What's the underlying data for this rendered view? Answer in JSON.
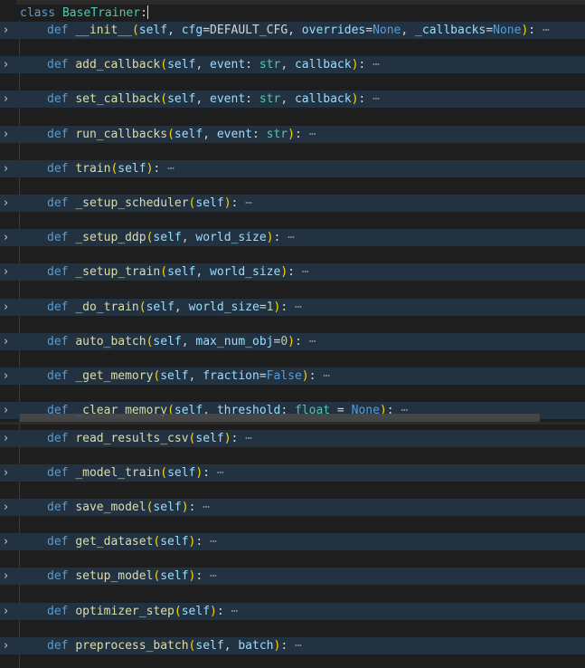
{
  "editor": {
    "class_line": {
      "keyword": "class",
      "name": "BaseTrainer",
      "colon": ":"
    },
    "methods": [
      {
        "name": "__init__",
        "tokens": [
          {
            "t": "(",
            "c": "paren"
          },
          {
            "t": "self",
            "c": "param"
          },
          {
            "t": ", ",
            "c": "plain"
          },
          {
            "t": "cfg",
            "c": "param"
          },
          {
            "t": "=",
            "c": "plain"
          },
          {
            "t": "DEFAULT_CFG",
            "c": "plain"
          },
          {
            "t": ", ",
            "c": "plain"
          },
          {
            "t": "overrides",
            "c": "param"
          },
          {
            "t": "=",
            "c": "plain"
          },
          {
            "t": "None",
            "c": "const"
          },
          {
            "t": ", ",
            "c": "plain"
          },
          {
            "t": "_callbacks",
            "c": "param"
          },
          {
            "t": "=",
            "c": "plain"
          },
          {
            "t": "None",
            "c": "const"
          },
          {
            "t": ")",
            "c": "paren"
          },
          {
            "t": ":",
            "c": "plain"
          }
        ]
      },
      {
        "name": "add_callback",
        "tokens": [
          {
            "t": "(",
            "c": "paren"
          },
          {
            "t": "self",
            "c": "param"
          },
          {
            "t": ", ",
            "c": "plain"
          },
          {
            "t": "event",
            "c": "param"
          },
          {
            "t": ": ",
            "c": "plain"
          },
          {
            "t": "str",
            "c": "bltin"
          },
          {
            "t": ", ",
            "c": "plain"
          },
          {
            "t": "callback",
            "c": "param"
          },
          {
            "t": ")",
            "c": "paren"
          },
          {
            "t": ":",
            "c": "plain"
          }
        ]
      },
      {
        "name": "set_callback",
        "tokens": [
          {
            "t": "(",
            "c": "paren"
          },
          {
            "t": "self",
            "c": "param"
          },
          {
            "t": ", ",
            "c": "plain"
          },
          {
            "t": "event",
            "c": "param"
          },
          {
            "t": ": ",
            "c": "plain"
          },
          {
            "t": "str",
            "c": "bltin"
          },
          {
            "t": ", ",
            "c": "plain"
          },
          {
            "t": "callback",
            "c": "param"
          },
          {
            "t": ")",
            "c": "paren"
          },
          {
            "t": ":",
            "c": "plain"
          }
        ]
      },
      {
        "name": "run_callbacks",
        "tokens": [
          {
            "t": "(",
            "c": "paren"
          },
          {
            "t": "self",
            "c": "param"
          },
          {
            "t": ", ",
            "c": "plain"
          },
          {
            "t": "event",
            "c": "param"
          },
          {
            "t": ": ",
            "c": "plain"
          },
          {
            "t": "str",
            "c": "bltin"
          },
          {
            "t": ")",
            "c": "paren"
          },
          {
            "t": ":",
            "c": "plain"
          }
        ]
      },
      {
        "name": "train",
        "tokens": [
          {
            "t": "(",
            "c": "paren"
          },
          {
            "t": "self",
            "c": "param"
          },
          {
            "t": ")",
            "c": "paren"
          },
          {
            "t": ":",
            "c": "plain"
          }
        ]
      },
      {
        "name": "_setup_scheduler",
        "tokens": [
          {
            "t": "(",
            "c": "paren"
          },
          {
            "t": "self",
            "c": "param"
          },
          {
            "t": ")",
            "c": "paren"
          },
          {
            "t": ":",
            "c": "plain"
          }
        ]
      },
      {
        "name": "_setup_ddp",
        "tokens": [
          {
            "t": "(",
            "c": "paren"
          },
          {
            "t": "self",
            "c": "param"
          },
          {
            "t": ", ",
            "c": "plain"
          },
          {
            "t": "world_size",
            "c": "param"
          },
          {
            "t": ")",
            "c": "paren"
          },
          {
            "t": ":",
            "c": "plain"
          }
        ]
      },
      {
        "name": "_setup_train",
        "tokens": [
          {
            "t": "(",
            "c": "paren"
          },
          {
            "t": "self",
            "c": "param"
          },
          {
            "t": ", ",
            "c": "plain"
          },
          {
            "t": "world_size",
            "c": "param"
          },
          {
            "t": ")",
            "c": "paren"
          },
          {
            "t": ":",
            "c": "plain"
          }
        ]
      },
      {
        "name": "_do_train",
        "tokens": [
          {
            "t": "(",
            "c": "paren"
          },
          {
            "t": "self",
            "c": "param"
          },
          {
            "t": ", ",
            "c": "plain"
          },
          {
            "t": "world_size",
            "c": "param"
          },
          {
            "t": "=",
            "c": "plain"
          },
          {
            "t": "1",
            "c": "num"
          },
          {
            "t": ")",
            "c": "paren"
          },
          {
            "t": ":",
            "c": "plain"
          }
        ]
      },
      {
        "name": "auto_batch",
        "tokens": [
          {
            "t": "(",
            "c": "paren"
          },
          {
            "t": "self",
            "c": "param"
          },
          {
            "t": ", ",
            "c": "plain"
          },
          {
            "t": "max_num_obj",
            "c": "param"
          },
          {
            "t": "=",
            "c": "plain"
          },
          {
            "t": "0",
            "c": "num"
          },
          {
            "t": ")",
            "c": "paren"
          },
          {
            "t": ":",
            "c": "plain"
          }
        ]
      },
      {
        "name": "_get_memory",
        "tokens": [
          {
            "t": "(",
            "c": "paren"
          },
          {
            "t": "self",
            "c": "param"
          },
          {
            "t": ", ",
            "c": "plain"
          },
          {
            "t": "fraction",
            "c": "param"
          },
          {
            "t": "=",
            "c": "plain"
          },
          {
            "t": "False",
            "c": "const"
          },
          {
            "t": ")",
            "c": "paren"
          },
          {
            "t": ":",
            "c": "plain"
          }
        ]
      },
      {
        "name": "_clear_memory",
        "tokens": [
          {
            "t": "(",
            "c": "paren"
          },
          {
            "t": "self",
            "c": "param"
          },
          {
            "t": ", ",
            "c": "plain"
          },
          {
            "t": "threshold",
            "c": "param"
          },
          {
            "t": ": ",
            "c": "plain"
          },
          {
            "t": "float",
            "c": "bltin"
          },
          {
            "t": " = ",
            "c": "plain"
          },
          {
            "t": "None",
            "c": "const"
          },
          {
            "t": ")",
            "c": "paren"
          },
          {
            "t": ":",
            "c": "plain"
          }
        ]
      },
      {
        "name": "read_results_csv",
        "tokens": [
          {
            "t": "(",
            "c": "paren"
          },
          {
            "t": "self",
            "c": "param"
          },
          {
            "t": ")",
            "c": "paren"
          },
          {
            "t": ":",
            "c": "plain"
          }
        ]
      },
      {
        "name": "_model_train",
        "tokens": [
          {
            "t": "(",
            "c": "paren"
          },
          {
            "t": "self",
            "c": "param"
          },
          {
            "t": ")",
            "c": "paren"
          },
          {
            "t": ":",
            "c": "plain"
          }
        ]
      },
      {
        "name": "save_model",
        "tokens": [
          {
            "t": "(",
            "c": "paren"
          },
          {
            "t": "self",
            "c": "param"
          },
          {
            "t": ")",
            "c": "paren"
          },
          {
            "t": ":",
            "c": "plain"
          }
        ]
      },
      {
        "name": "get_dataset",
        "tokens": [
          {
            "t": "(",
            "c": "paren"
          },
          {
            "t": "self",
            "c": "param"
          },
          {
            "t": ")",
            "c": "paren"
          },
          {
            "t": ":",
            "c": "plain"
          }
        ]
      },
      {
        "name": "setup_model",
        "tokens": [
          {
            "t": "(",
            "c": "paren"
          },
          {
            "t": "self",
            "c": "param"
          },
          {
            "t": ")",
            "c": "paren"
          },
          {
            "t": ":",
            "c": "plain"
          }
        ]
      },
      {
        "name": "optimizer_step",
        "tokens": [
          {
            "t": "(",
            "c": "paren"
          },
          {
            "t": "self",
            "c": "param"
          },
          {
            "t": ")",
            "c": "paren"
          },
          {
            "t": ":",
            "c": "plain"
          }
        ]
      },
      {
        "name": "preprocess_batch",
        "tokens": [
          {
            "t": "(",
            "c": "paren"
          },
          {
            "t": "self",
            "c": "param"
          },
          {
            "t": ", ",
            "c": "plain"
          },
          {
            "t": "batch",
            "c": "param"
          },
          {
            "t": ")",
            "c": "paren"
          },
          {
            "t": ":",
            "c": "plain"
          }
        ]
      }
    ],
    "def_keyword": "def",
    "fold_ellipsis": "⋯",
    "fold_icon": "chevron-right-icon",
    "colors": {
      "background": "#1e1e1e",
      "folded_line": "#233240",
      "keyword": "#569cd6",
      "class_name": "#4ec9b0",
      "function": "#dcdcaa",
      "parameter": "#9cdcfe",
      "paren": "#ffd700"
    }
  }
}
